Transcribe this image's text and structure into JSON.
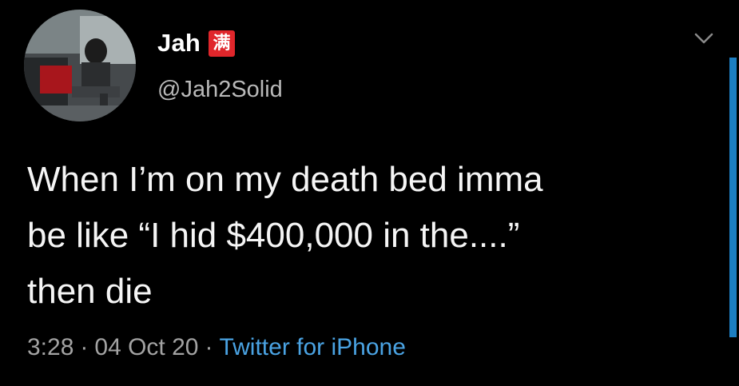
{
  "tweet": {
    "display_name": "Jah",
    "name_badge": "满",
    "handle": "@Jah2Solid",
    "text_lines": [
      "When I’m on my death bed imma",
      "be like “I hid $400,000 in the....”",
      "then die"
    ],
    "time": "3:28",
    "separator": "·",
    "date": "04 Oct 20",
    "source": "Twitter for iPhone"
  },
  "icons": {
    "more": "chevron-down-icon"
  },
  "colors": {
    "background": "#000000",
    "text": "#f5f5f5",
    "muted": "#a3a3a3",
    "link": "#4aa3e3",
    "badge": "#e0262b",
    "accent_bar": "#1d7ec2"
  }
}
